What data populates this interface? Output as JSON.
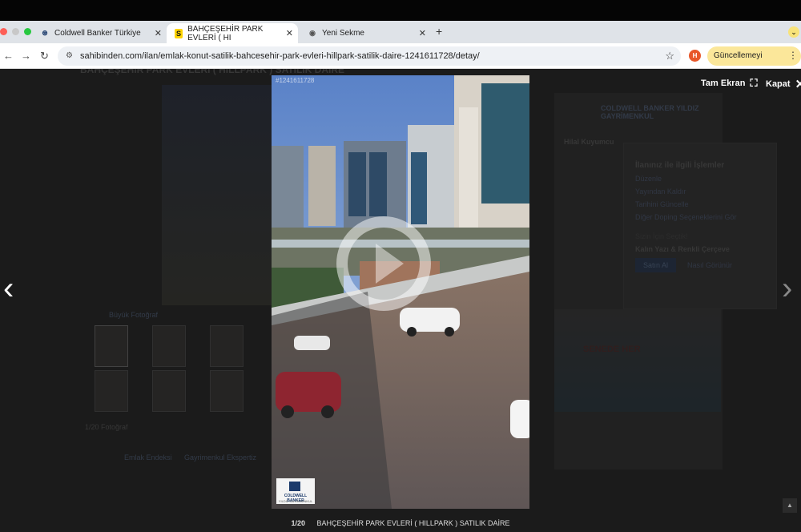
{
  "browser": {
    "tabs": [
      {
        "label": "Coldwell Banker Türkiye",
        "favicon": "coldwell-banker-icon"
      },
      {
        "label": "BAHÇEŞEHİR PARK EVLERİ ( HI",
        "favicon": "sahibinden-icon",
        "active": true
      },
      {
        "label": "Yeni Sekme",
        "favicon": "chrome-icon"
      }
    ],
    "url": "sahibinden.com/ilan/emlak-konut-satilik-bahcesehir-park-evleri-hillpark-satilik-daire-1241611728/detay/",
    "update_label": "Güncellemeyi tamamla",
    "extension_badge": "H"
  },
  "viewer": {
    "fullscreen_label": "Tam Ekran",
    "close_label": "Kapat",
    "counter": "1/20",
    "caption": "BAHÇEŞEHİR PARK EVLERİ ( HILLPARK ) SATILIK DAİRE",
    "watermark_id": "#1241611728",
    "logo_text": "COLDWELL BANKER",
    "logo_sub": "YILDIZ GAYRİMENKUL"
  },
  "background_page": {
    "title": "BAHÇEŞEHİR PARK EVLERİ ( HILLPARK ) SATILIK DAİRE",
    "big_photo_link": "Büyük Fotoğraf",
    "photo_count": "1/20 Fotoğraf",
    "tabs": [
      "Emlak Endeksi",
      "Gayrimenkul Ekspertiz"
    ],
    "agency_name": "COLDWELL BANKER YILDIZ GAYRİMENKUL",
    "agent_name": "Hilal Kuyumcu",
    "popup_title": "İlanınız ile ilgili İşlemler",
    "popup_items": [
      "Düzenle",
      "Yayından Kaldır",
      "Tarihini Güncelle",
      "Diğer Doping Seçeneklerini Gör"
    ],
    "popup_offer_title": "Sizin İçin Seçtik!",
    "popup_offer": "Kalın Yazı & Renkli Çerçeve",
    "popup_buy": "Satın Al",
    "popup_info": "Nasıl Görünür",
    "banner_text": "SENEDE HER"
  }
}
